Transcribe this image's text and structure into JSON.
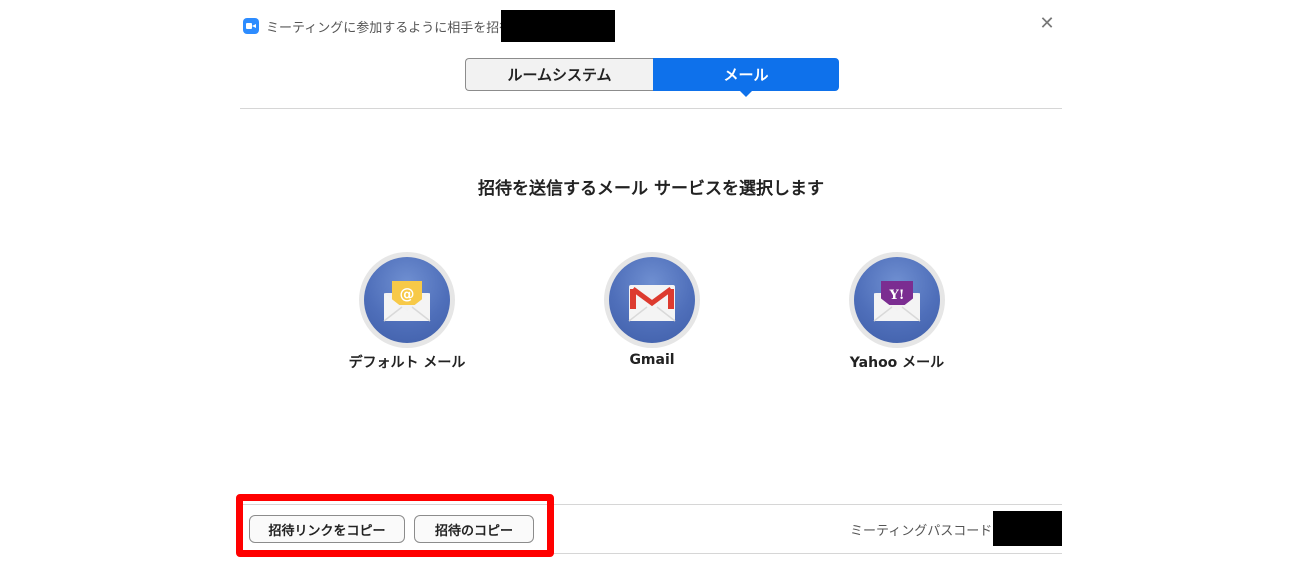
{
  "window": {
    "title": "ミーティングに参加するように相手を招待"
  },
  "tabs": [
    {
      "label": "ルームシステム",
      "selected": false
    },
    {
      "label": "メール",
      "selected": true
    }
  ],
  "main": {
    "heading": "招待を送信するメール サービスを選択します",
    "services": [
      {
        "label": "デフォルト メール",
        "icon": "default-mail-icon"
      },
      {
        "label": "Gmail",
        "icon": "gmail-icon"
      },
      {
        "label": "Yahoo メール",
        "icon": "yahoo-mail-icon"
      }
    ]
  },
  "footer": {
    "copy_link_label": "招待リンクをコピー",
    "copy_invitation_label": "招待のコピー",
    "passcode_label": "ミーティングパスコード："
  },
  "colors": {
    "accent": "#0E71EB",
    "highlight": "#FF0000",
    "zoom_blue": "#2D8CFF"
  }
}
